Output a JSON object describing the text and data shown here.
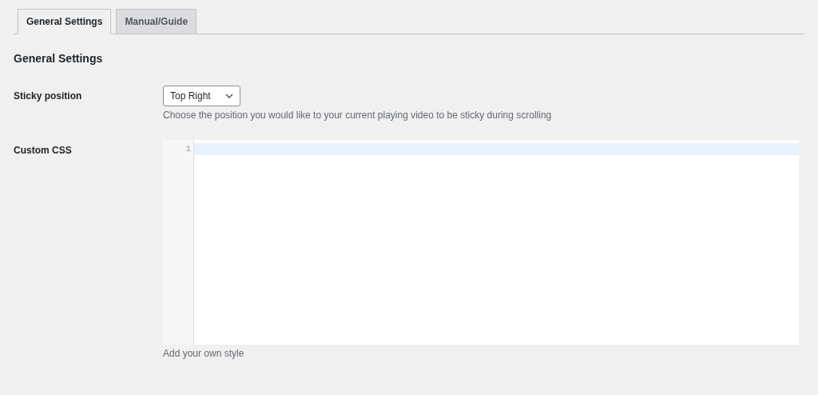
{
  "tabs": [
    {
      "label": "General Settings",
      "selected": true
    },
    {
      "label": "Manual/Guide",
      "selected": false
    }
  ],
  "section_title": "General Settings",
  "fields": [
    {
      "kind": "select",
      "label": "Sticky position",
      "value": "Top Right",
      "description": "Choose the position you would like to your current playing video to be sticky during scrolling"
    },
    {
      "kind": "code",
      "label": "Custom CSS",
      "line_numbers": [
        "1"
      ],
      "description": "Add your own style"
    }
  ]
}
